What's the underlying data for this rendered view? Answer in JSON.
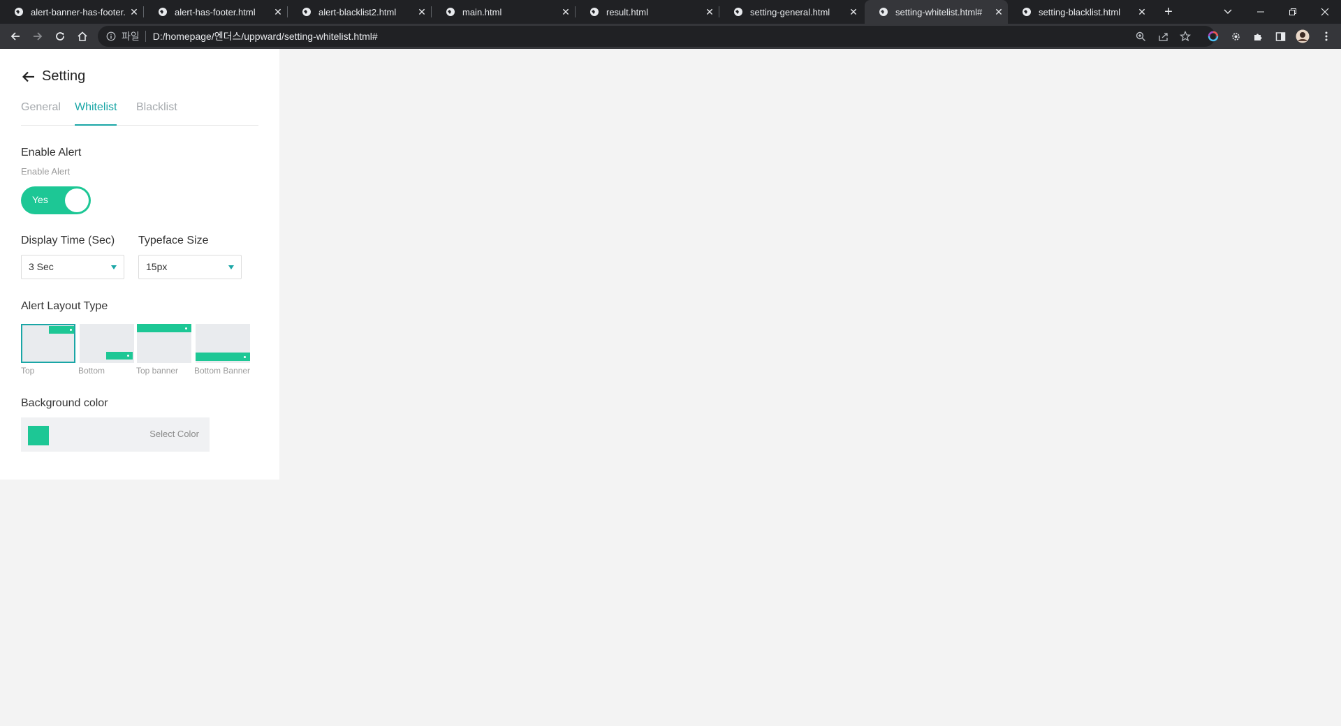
{
  "browser": {
    "tabs": [
      {
        "title": "alert-banner-has-footer.html"
      },
      {
        "title": "alert-has-footer.html"
      },
      {
        "title": "alert-blacklist2.html"
      },
      {
        "title": "main.html"
      },
      {
        "title": "result.html"
      },
      {
        "title": "setting-general.html"
      },
      {
        "title": "setting-whitelist.html#"
      },
      {
        "title": "setting-blacklist.html"
      }
    ],
    "active_tab": "setting-whitelist.html#",
    "close_glyph": "✕",
    "new_tab_glyph": "+",
    "address": {
      "scheme_label": "파일",
      "url": "D:/homepage/엔더스/uppward/setting-whitelist.html#"
    },
    "icons": [
      "back-icon",
      "forward-icon",
      "reload-icon",
      "home-icon",
      "info-icon",
      "zoom-icon",
      "share-icon",
      "star-icon",
      "extensions-icon",
      "side-panel-icon",
      "profile-avatar",
      "menu-icon"
    ]
  },
  "page": {
    "title": "Setting",
    "tabs": [
      {
        "label": "General",
        "active": false
      },
      {
        "label": "Whitelist",
        "active": true
      },
      {
        "label": "Blacklist",
        "active": false
      }
    ],
    "enable_alert": {
      "label": "Enable Alert",
      "sublabel": "Enable Alert",
      "toggle_text": "Yes",
      "on": true
    },
    "display_time": {
      "label": "Display Time (Sec)",
      "value": "3 Sec"
    },
    "typeface_size": {
      "label": "Typeface Size",
      "value": "15px"
    },
    "alert_layout": {
      "label": "Alert Layout Type",
      "options": [
        {
          "caption": "Top",
          "selected": true
        },
        {
          "caption": "Bottom",
          "selected": false
        },
        {
          "caption": "Top banner",
          "selected": false
        },
        {
          "caption": "Bottom Banner",
          "selected": false
        }
      ]
    },
    "background_color": {
      "label": "Background color",
      "swatch_color": "#1dc795",
      "button_label": "Select Color"
    },
    "colors": {
      "accent": "#1aa6a6",
      "green": "#1dc795"
    }
  }
}
